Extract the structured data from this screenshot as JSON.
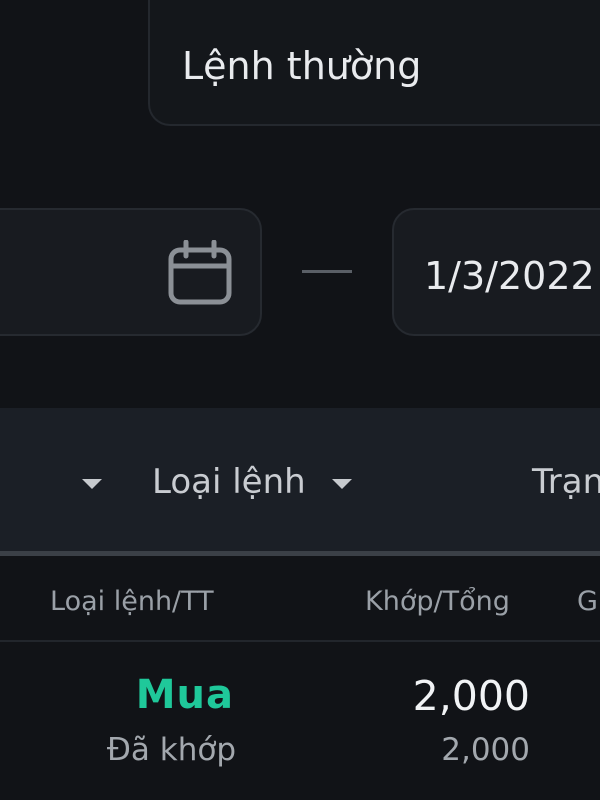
{
  "order_type_select": {
    "value": "Lệnh thường"
  },
  "date_range": {
    "to_value": "1/3/2022"
  },
  "filters": {
    "order_type_label": "Loại lệnh",
    "status_label": "Trạn"
  },
  "table": {
    "headers": {
      "order_type_status": "Loại lệnh/TT",
      "matched_total": "Khớp/Tổng",
      "next": "G"
    },
    "rows": [
      {
        "side": "Mua",
        "status": "Đã khớp",
        "matched": "2,000",
        "total": "2,000"
      }
    ]
  },
  "colors": {
    "background": "#111317",
    "buy": "#1fc89a",
    "text_primary": "#e9ebee",
    "text_secondary": "#a3a8ae"
  },
  "icons": {
    "date_picker": "calendar-icon",
    "dropdown": "caret-down-icon"
  }
}
